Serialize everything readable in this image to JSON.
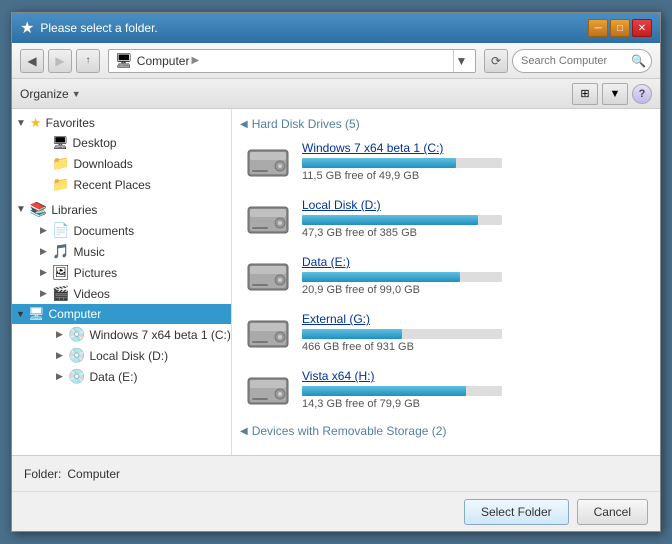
{
  "window": {
    "title": "Please select a folder.",
    "title_icon": "★"
  },
  "toolbar": {
    "breadcrumb_icon": "🖥",
    "breadcrumb_label": "Computer",
    "breadcrumb_arrow": "▶",
    "search_placeholder": "Search Computer",
    "refresh_label": "⟳",
    "back_label": "◀",
    "forward_label": "▶"
  },
  "organize": {
    "label": "Organize",
    "arrow": "▼",
    "help": "?"
  },
  "sidebar": {
    "favorites_label": "Favorites",
    "favorites_icon": "★",
    "desktop_label": "Desktop",
    "desktop_icon": "🖥",
    "downloads_label": "Downloads",
    "downloads_icon": "📁",
    "recent_label": "Recent Places",
    "recent_icon": "📁",
    "libraries_label": "Libraries",
    "libraries_icon": "📚",
    "documents_label": "Documents",
    "documents_icon": "📄",
    "music_label": "Music",
    "music_icon": "🎵",
    "pictures_label": "Pictures",
    "pictures_icon": "🖼",
    "videos_label": "Videos",
    "videos_icon": "🎬",
    "computer_label": "Computer",
    "computer_icon": "🖥",
    "win7_label": "Windows 7 x64 beta 1 (C:)",
    "win7_icon": "💿",
    "locald_label": "Local Disk (D:)",
    "locald_icon": "💿",
    "datae_label": "Data (E:)",
    "datae_icon": "💿"
  },
  "main": {
    "hard_disk_title": "Hard Disk Drives (5)",
    "devices_title": "Devices with Removable Storage (2)",
    "drives": [
      {
        "name": "Windows 7 x64 beta 1 (C:)",
        "free": "11,5 GB free of 49,9 GB",
        "fill_percent": 77
      },
      {
        "name": "Local Disk (D:)",
        "free": "47,3 GB free of 385 GB",
        "fill_percent": 88
      },
      {
        "name": "Data (E:)",
        "free": "20,9 GB free of 99,0 GB",
        "fill_percent": 79
      },
      {
        "name": "External (G:)",
        "free": "466 GB free of 931 GB",
        "fill_percent": 50
      },
      {
        "name": "Vista x64 (H:)",
        "free": "14,3 GB free of 79,9 GB",
        "fill_percent": 82
      }
    ]
  },
  "bottom": {
    "folder_label": "Folder:",
    "folder_value": "Computer"
  },
  "buttons": {
    "select_label": "Select Folder",
    "cancel_label": "Cancel"
  }
}
